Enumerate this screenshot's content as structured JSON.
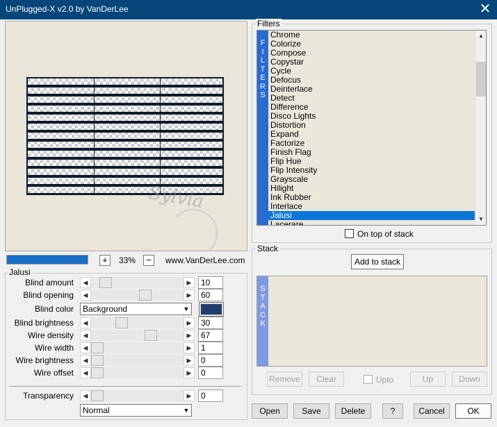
{
  "window": {
    "title": "UnPlugged-X v2.0 by VanDerLee",
    "close_glyph": "✕"
  },
  "preview": {
    "watermark": "Sylvia"
  },
  "toolbar": {
    "progress_percent": 100,
    "zoom_in": "+",
    "zoom_value": "33%",
    "zoom_out": "−",
    "link": "www.VanDerLee.com"
  },
  "jalusi": {
    "title": "Jalusi",
    "params": [
      {
        "label": "Blind amount",
        "type": "slider",
        "value": "10",
        "level": 0.1
      },
      {
        "label": "Blind opening",
        "type": "slider",
        "value": "60",
        "level": 0.6
      },
      {
        "label": "Blind color",
        "type": "combo",
        "value": "Background",
        "swatch": "#213b6b"
      },
      {
        "label": "Blind brightness",
        "type": "slider",
        "value": "30",
        "level": 0.3
      },
      {
        "label": "Wire density",
        "type": "slider",
        "value": "67",
        "level": 0.67
      },
      {
        "label": "Wire width",
        "type": "slider",
        "value": "1",
        "level": 0.0
      },
      {
        "label": "Wire brightness",
        "type": "slider",
        "value": "0",
        "level": 0.0
      },
      {
        "label": "Wire offset",
        "type": "slider",
        "value": "0",
        "level": 0.0
      }
    ],
    "transparency": {
      "label": "Transparency",
      "value": "0",
      "level": 0.0
    },
    "blend_mode": "Normal"
  },
  "filters": {
    "title": "Filters",
    "strip_label": [
      "F",
      "I",
      "L",
      "T",
      "E",
      "R",
      "S"
    ],
    "items": [
      "Chrome",
      "Colorize",
      "Compose",
      "Copystar",
      "Cycle",
      "Defocus",
      "Deinterlace",
      "Detect",
      "Difference",
      "Disco Lights",
      "Distortion",
      "Expand",
      "Factorize",
      "Finish Flag",
      "Flip Hue",
      "Flip Intensity",
      "Grayscale",
      "Hilight",
      "Ink Rubber",
      "Interlace",
      "Jalusi",
      "Lacerare"
    ],
    "selected": "Jalusi",
    "on_top_label": "On top of stack",
    "on_top_checked": false
  },
  "stack": {
    "title": "Stack",
    "strip_label": [
      "S",
      "T",
      "A",
      "C",
      "K"
    ],
    "add_label": "Add to stack",
    "remove_label": "Remove",
    "clear_label": "Clear",
    "upto_label": "Upto",
    "up_label": "Up",
    "down_label": "Down"
  },
  "footer": {
    "open": "Open",
    "save": "Save",
    "delete": "Delete",
    "help": "?",
    "cancel": "Cancel",
    "ok": "OK"
  },
  "colors": {
    "titlebar": "#06467a",
    "accent": "#0a77d8",
    "filters_strip": "#2a6bd0",
    "stack_strip": "#7e9ae0"
  }
}
